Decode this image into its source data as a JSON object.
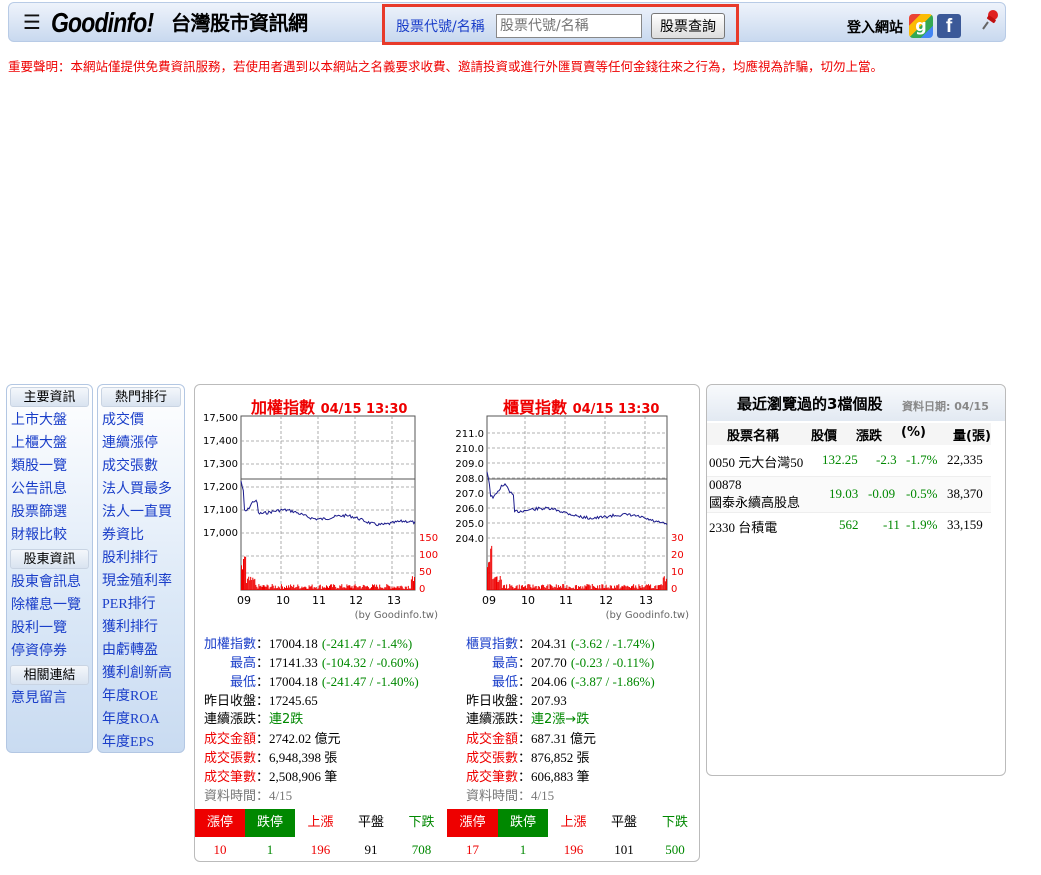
{
  "header": {
    "logo": "Goodinfo!",
    "site_title": "台灣股市資訊網",
    "search_label": "股票代號/名稱",
    "search_placeholder": "股票代號/名稱",
    "search_button": "股票查詢",
    "login": "登入網站"
  },
  "notice": "重要聲明：本網站僅提供免費資訊服務，若使用者遇到以本網站之名義要求收費、邀請投資或進行外匯買賣等任何金錢往來之行為，均應視為詐騙，切勿上當。",
  "menu_main": {
    "sections": [
      {
        "head": "主要資訊",
        "items": [
          "上市大盤",
          "上櫃大盤",
          "類股一覽",
          "公告訊息",
          "股票篩選",
          "財報比較"
        ]
      },
      {
        "head": "股東資訊",
        "items": [
          "股東會訊息",
          "除權息一覽",
          "股利一覽",
          "停資停券"
        ]
      },
      {
        "head": "相關連結",
        "items": [
          "意見留言"
        ]
      }
    ]
  },
  "menu_hot": {
    "head": "熱門排行",
    "items": [
      "成交價",
      "連續漲停",
      "成交張數",
      "法人買最多",
      "法人一直買",
      "券資比",
      "股利排行",
      "現金殖利率",
      "PER排行",
      "獲利排行",
      "由虧轉盈",
      "獲利創新高",
      "年度ROE",
      "年度ROA",
      "年度EPS"
    ]
  },
  "twse": {
    "title": "加權指數",
    "timestamp": "04/15 13:30",
    "yticks": [
      "17,500",
      "17,400",
      "17,300",
      "17,200",
      "17,100",
      "17,000"
    ],
    "vticks": [
      "150",
      "100",
      "50",
      "0"
    ],
    "xticks": [
      "09",
      "10",
      "11",
      "12",
      "13"
    ],
    "credit": "(by Goodinfo.tw)",
    "index_label": "加權指數",
    "index_value": "17004.18",
    "index_chg": "(-241.47 / -1.4%)",
    "high_label": "最高",
    "high_value": "17141.33",
    "high_chg": "(-104.32 / -0.60%)",
    "low_label": "最低",
    "low_value": "17004.18",
    "low_chg": "(-241.47 / -1.40%)",
    "prev_label": "昨日收盤",
    "prev_value": "17245.65",
    "streak_label": "連續漲跌",
    "streak_value": "連2跌",
    "amount_label": "成交金額",
    "amount_value": "2742.02 億元",
    "volume_label": "成交張數",
    "volume_value": "6,948,398 張",
    "trades_label": "成交筆數",
    "trades_value": "2,508,906 筆",
    "time_label": "資料時間",
    "time_value": "4/15",
    "stats": {
      "limit_up": "10",
      "limit_down": "1",
      "up": "196",
      "flat": "91",
      "down": "708"
    }
  },
  "otc": {
    "title": "櫃買指數",
    "timestamp": "04/15 13:30",
    "yticks": [
      "211.0",
      "210.0",
      "209.0",
      "208.0",
      "207.0",
      "206.0",
      "205.0",
      "204.0"
    ],
    "vticks": [
      "30",
      "20",
      "10",
      "0"
    ],
    "xticks": [
      "09",
      "10",
      "11",
      "12",
      "13"
    ],
    "credit": "(by Goodinfo.tw)",
    "index_label": "櫃買指數",
    "index_value": "204.31",
    "index_chg": "(-3.62 / -1.74%)",
    "high_label": "最高",
    "high_value": "207.70",
    "high_chg": "(-0.23 / -0.11%)",
    "low_label": "最低",
    "low_value": "204.06",
    "low_chg": "(-3.87 / -1.86%)",
    "prev_label": "昨日收盤",
    "prev_value": "207.93",
    "streak_label": "連續漲跌",
    "streak_value": "連2漲→跌",
    "amount_label": "成交金額",
    "amount_value": "687.31 億元",
    "volume_label": "成交張數",
    "volume_value": "876,852 張",
    "trades_label": "成交筆數",
    "trades_value": "606,883 筆",
    "time_label": "資料時間",
    "time_value": "4/15",
    "stats": {
      "limit_up": "17",
      "limit_down": "1",
      "up": "196",
      "flat": "101",
      "down": "500"
    }
  },
  "stats_headers": {
    "limit_up": "漲停",
    "limit_down": "跌停",
    "up": "上漲",
    "flat": "平盤",
    "down": "下跌"
  },
  "recent": {
    "title": "最近瀏覽過的3檔個股",
    "date": "資料日期: 04/15",
    "columns": [
      "股票名稱",
      "股價",
      "漲跌",
      "(%)",
      "量(張)"
    ],
    "rows": [
      {
        "name": "0050 元大台灣50",
        "name2": "",
        "price": "132.25",
        "chg": "-2.3",
        "pct": "-1.7%",
        "vol": "22,335"
      },
      {
        "name": "00878",
        "name2": "國泰永續高股息",
        "price": "19.03",
        "chg": "-0.09",
        "pct": "-0.5%",
        "vol": "38,370"
      },
      {
        "name": "2330 台積電",
        "name2": "",
        "price": "562",
        "chg": "-11",
        "pct": "-1.9%",
        "vol": "33,159"
      }
    ]
  },
  "colors": {
    "accent_red": "#e00000",
    "link_blue": "#1a3ec9",
    "down_green": "#008000"
  }
}
